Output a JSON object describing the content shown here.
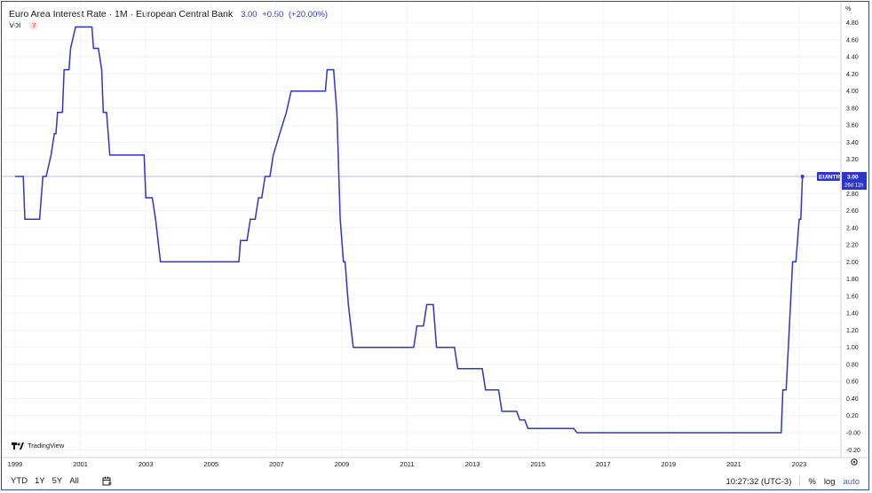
{
  "header": {
    "title": "Euro Area Interest Rate · 1M · European Central Bank",
    "last_value": "3.00",
    "change": "+0.50",
    "change_pct": "(+20.00%)",
    "vol_label": "Vol",
    "warning_glyph": "?"
  },
  "axis": {
    "unit_label": "%",
    "y_ticks": [
      "4.80",
      "4.60",
      "4.40",
      "4.20",
      "4.00",
      "3.80",
      "3.60",
      "3.40",
      "3.20",
      "3.00",
      "2.80",
      "2.60",
      "2.40",
      "2.20",
      "2.00",
      "1.80",
      "1.60",
      "1.40",
      "1.20",
      "1.00",
      "0.80",
      "0.60",
      "0.40",
      "0.20",
      "-0.00",
      "-0.20"
    ],
    "x_ticks": [
      "1999",
      "2001",
      "2003",
      "2005",
      "2007",
      "2009",
      "2011",
      "2013",
      "2015",
      "2017",
      "2019",
      "2021",
      "2023"
    ]
  },
  "price_tag": {
    "symbol": "EUINTR",
    "value": "3.00",
    "countdown": "26d 11h"
  },
  "footer": {
    "ranges": [
      "YTD",
      "1Y",
      "5Y",
      "All"
    ],
    "time": "10:27:32 (UTC-3)",
    "pct": "%",
    "log": "log",
    "auto": "auto"
  },
  "branding": {
    "name": "TradingView"
  },
  "colors": {
    "line": "#2f35c8",
    "accent": "#2962ff",
    "frame": "#2b4f9e",
    "grid": "#f0f3fa"
  },
  "chart_data": {
    "type": "line",
    "title": "Euro Area Interest Rate · 1M · European Central Bank",
    "xlabel": "",
    "ylabel": "%",
    "ylim": [
      -0.2,
      4.9
    ],
    "xlim": [
      1998.9,
      2024.3
    ],
    "grid": true,
    "series": [
      {
        "name": "Euro Area Interest Rate",
        "x": [
          1999.0,
          1999.25,
          1999.3,
          1999.75,
          1999.85,
          1999.95,
          2000.1,
          2000.2,
          2000.25,
          2000.3,
          2000.45,
          2000.5,
          2000.65,
          2000.7,
          2000.85,
          2001.35,
          2001.4,
          2001.55,
          2001.65,
          2001.7,
          2001.8,
          2001.9,
          2002.95,
          2003.0,
          2003.2,
          2003.3,
          2003.45,
          2005.85,
          2005.9,
          2006.1,
          2006.2,
          2006.35,
          2006.45,
          2006.55,
          2006.65,
          2006.8,
          2006.9,
          2007.1,
          2007.3,
          2007.45,
          2008.5,
          2008.55,
          2008.75,
          2008.85,
          2008.95,
          2009.05,
          2009.1,
          2009.2,
          2009.35,
          2011.2,
          2011.3,
          2011.5,
          2011.6,
          2011.8,
          2011.9,
          2012.45,
          2012.55,
          2013.3,
          2013.4,
          2013.8,
          2013.9,
          2014.35,
          2014.45,
          2014.6,
          2014.7,
          2016.1,
          2016.2,
          2022.45,
          2022.5,
          2022.6,
          2022.7,
          2022.8,
          2022.9,
          2023.0,
          2023.05,
          2023.1
        ],
        "y": [
          3.0,
          3.0,
          2.5,
          2.5,
          3.0,
          3.0,
          3.25,
          3.5,
          3.5,
          3.75,
          3.75,
          4.25,
          4.25,
          4.5,
          4.75,
          4.75,
          4.5,
          4.5,
          4.25,
          3.75,
          3.75,
          3.25,
          3.25,
          2.75,
          2.75,
          2.5,
          2.0,
          2.0,
          2.25,
          2.25,
          2.5,
          2.5,
          2.75,
          2.75,
          3.0,
          3.0,
          3.25,
          3.5,
          3.75,
          4.0,
          4.0,
          4.25,
          4.25,
          3.75,
          2.5,
          2.0,
          2.0,
          1.5,
          1.0,
          1.0,
          1.25,
          1.25,
          1.5,
          1.5,
          1.0,
          1.0,
          0.75,
          0.75,
          0.5,
          0.5,
          0.25,
          0.25,
          0.15,
          0.15,
          0.05,
          0.05,
          0.0,
          0.0,
          0.5,
          0.5,
          1.25,
          2.0,
          2.0,
          2.5,
          2.5,
          3.0
        ]
      }
    ]
  }
}
